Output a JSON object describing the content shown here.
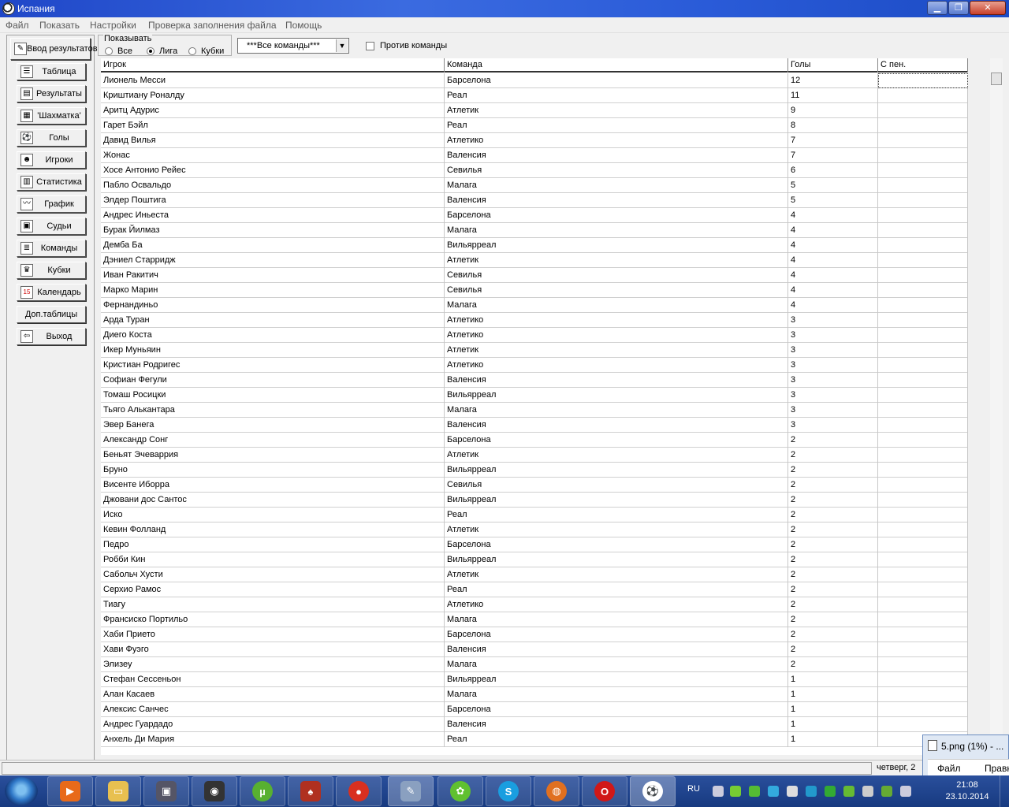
{
  "window": {
    "title": "Испания"
  },
  "menu": [
    "Файл",
    "Показать",
    "Настройки",
    "Проверка заполнения файла",
    "Помощь"
  ],
  "nav": {
    "input_results": "Ввод результатов",
    "items": [
      "Таблица",
      "Результаты",
      "'Шахматка'",
      "Голы",
      "Игроки",
      "Статистика",
      "График",
      "Судьи",
      "Команды",
      "Кубки",
      "Календарь",
      "Доп.таблицы",
      "Выход"
    ]
  },
  "show": {
    "legend": "Показывать",
    "options": [
      "Все",
      "Лига",
      "Кубки"
    ],
    "selected": "Лига"
  },
  "team_filter": {
    "value": "***Все команды***"
  },
  "against_team": {
    "label": "Против команды",
    "checked": false
  },
  "table": {
    "columns": [
      "Игрок",
      "Команда",
      "Голы",
      "С пен."
    ],
    "rows": [
      [
        "Лионель Месси",
        "Барселона",
        "12",
        ""
      ],
      [
        "Криштиану Роналду",
        "Реал",
        "11",
        ""
      ],
      [
        "Аритц Адурис",
        "Атлетик",
        "9",
        ""
      ],
      [
        "Гарет Бэйл",
        "Реал",
        "8",
        ""
      ],
      [
        "Давид Вилья",
        "Атлетико",
        "7",
        ""
      ],
      [
        "Жонас",
        "Валенсия",
        "7",
        ""
      ],
      [
        "Хосе Антонио Рейес",
        "Севилья",
        "6",
        ""
      ],
      [
        "Пабло Освальдо",
        "Малага",
        "5",
        ""
      ],
      [
        "Элдер Поштига",
        "Валенсия",
        "5",
        ""
      ],
      [
        "Андрес Иньеста",
        "Барселона",
        "4",
        ""
      ],
      [
        "Бурак Йилмаз",
        "Малага",
        "4",
        ""
      ],
      [
        "Демба Ба",
        "Вильярреал",
        "4",
        ""
      ],
      [
        "Дэниел Старридж",
        "Атлетик",
        "4",
        ""
      ],
      [
        "Иван Ракитич",
        "Севилья",
        "4",
        ""
      ],
      [
        "Марко Марин",
        "Севилья",
        "4",
        ""
      ],
      [
        "Фернандиньо",
        "Малага",
        "4",
        ""
      ],
      [
        "Арда Туран",
        "Атлетико",
        "3",
        ""
      ],
      [
        "Диего Коста",
        "Атлетико",
        "3",
        ""
      ],
      [
        "Икер Муньяин",
        "Атлетик",
        "3",
        ""
      ],
      [
        "Кристиан Родригес",
        "Атлетико",
        "3",
        ""
      ],
      [
        "Софиан Фегули",
        "Валенсия",
        "3",
        ""
      ],
      [
        "Томаш Росицки",
        "Вильярреал",
        "3",
        ""
      ],
      [
        "Тьяго Алькантара",
        "Малага",
        "3",
        ""
      ],
      [
        "Эвер Банега",
        "Валенсия",
        "3",
        ""
      ],
      [
        "Александр Сонг",
        "Барселона",
        "2",
        ""
      ],
      [
        "Беньят Эчеваррия",
        "Атлетик",
        "2",
        ""
      ],
      [
        "Бруно",
        "Вильярреал",
        "2",
        ""
      ],
      [
        "Висенте Иборра",
        "Севилья",
        "2",
        ""
      ],
      [
        "Джовани дос Сантос",
        "Вильярреал",
        "2",
        ""
      ],
      [
        "Иско",
        "Реал",
        "2",
        ""
      ],
      [
        "Кевин Фолланд",
        "Атлетик",
        "2",
        ""
      ],
      [
        "Педро",
        "Барселона",
        "2",
        ""
      ],
      [
        "Робби Кин",
        "Вильярреал",
        "2",
        ""
      ],
      [
        "Сабольч Хусти",
        "Атлетик",
        "2",
        ""
      ],
      [
        "Серхио Рамос",
        "Реал",
        "2",
        ""
      ],
      [
        "Тиагу",
        "Атлетико",
        "2",
        ""
      ],
      [
        "Франсиско Портильо",
        "Малага",
        "2",
        ""
      ],
      [
        "Хаби Прието",
        "Барселона",
        "2",
        ""
      ],
      [
        "Хави Фуэго",
        "Валенсия",
        "2",
        ""
      ],
      [
        "Элизеу",
        "Малага",
        "2",
        ""
      ],
      [
        "Стефан Сессеньон",
        "Вильярреал",
        "1",
        ""
      ],
      [
        "Алан Касаев",
        "Малага",
        "1",
        ""
      ],
      [
        "Алексис Санчес",
        "Барселона",
        "1",
        ""
      ],
      [
        "Андрес Гуардадо",
        "Валенсия",
        "1",
        ""
      ],
      [
        "Анхель Ди Мария",
        "Реал",
        "1",
        ""
      ]
    ]
  },
  "status": {
    "date": "четверг, 2"
  },
  "popup": {
    "title": "5.png (1%) - ...",
    "menu": [
      "Файл",
      "Правка"
    ]
  },
  "taskbar": {
    "lang": "RU",
    "time": "21:08",
    "date": "23.10.2014",
    "apps": [
      "media-player",
      "file-explorer",
      "app-99",
      "camera",
      "utorrent",
      "card-game",
      "app-14",
      "image-editor",
      "icq",
      "skype",
      "firefox",
      "opera",
      "soccer-app"
    ]
  }
}
